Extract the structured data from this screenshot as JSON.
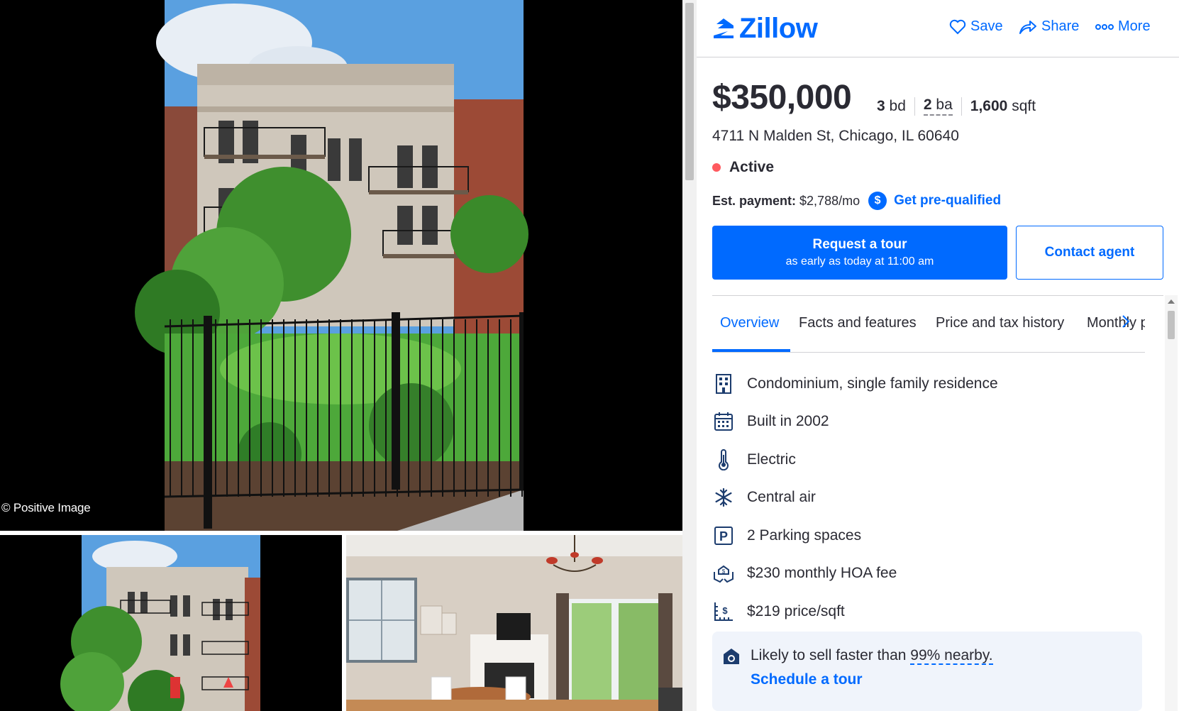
{
  "gallery": {
    "photo_credit": "© Positive Image"
  },
  "header": {
    "logo_text": "Zillow",
    "actions": {
      "save": "Save",
      "share": "Share",
      "more": "More"
    }
  },
  "listing": {
    "price": "$350,000",
    "beds": "3",
    "beds_unit": "bd",
    "baths": "2",
    "baths_unit": "ba",
    "sqft": "1,600",
    "sqft_unit": "sqft",
    "address": "4711 N Malden St, Chicago, IL 60640",
    "status": "Active",
    "payment_label": "Est. payment:",
    "payment_value": "$2,788/mo",
    "prequal_label": "Get pre-qualified"
  },
  "cta": {
    "tour_title": "Request a tour",
    "tour_subtitle": "as early as today at 11:00 am",
    "contact": "Contact agent"
  },
  "tabs": [
    "Overview",
    "Facts and features",
    "Price and tax history",
    "Monthly payment"
  ],
  "features": [
    {
      "icon": "building-icon",
      "text": "Condominium, single family residence"
    },
    {
      "icon": "calendar-icon",
      "text": "Built in 2002"
    },
    {
      "icon": "thermometer-icon",
      "text": "Electric"
    },
    {
      "icon": "snowflake-icon",
      "text": "Central air"
    },
    {
      "icon": "parking-icon",
      "text": "2 Parking spaces"
    },
    {
      "icon": "hoa-hands-icon",
      "text": "$230 monthly HOA fee"
    },
    {
      "icon": "price-per-sqft-icon",
      "text": "$219 price/sqft"
    }
  ],
  "promo": {
    "text_prefix": "Likely to sell faster than ",
    "text_highlight": "99% nearby.",
    "link": "Schedule a tour"
  },
  "colors": {
    "brand": "#006aff",
    "active_status": "#ff5a5f",
    "text": "#2a2a33"
  }
}
